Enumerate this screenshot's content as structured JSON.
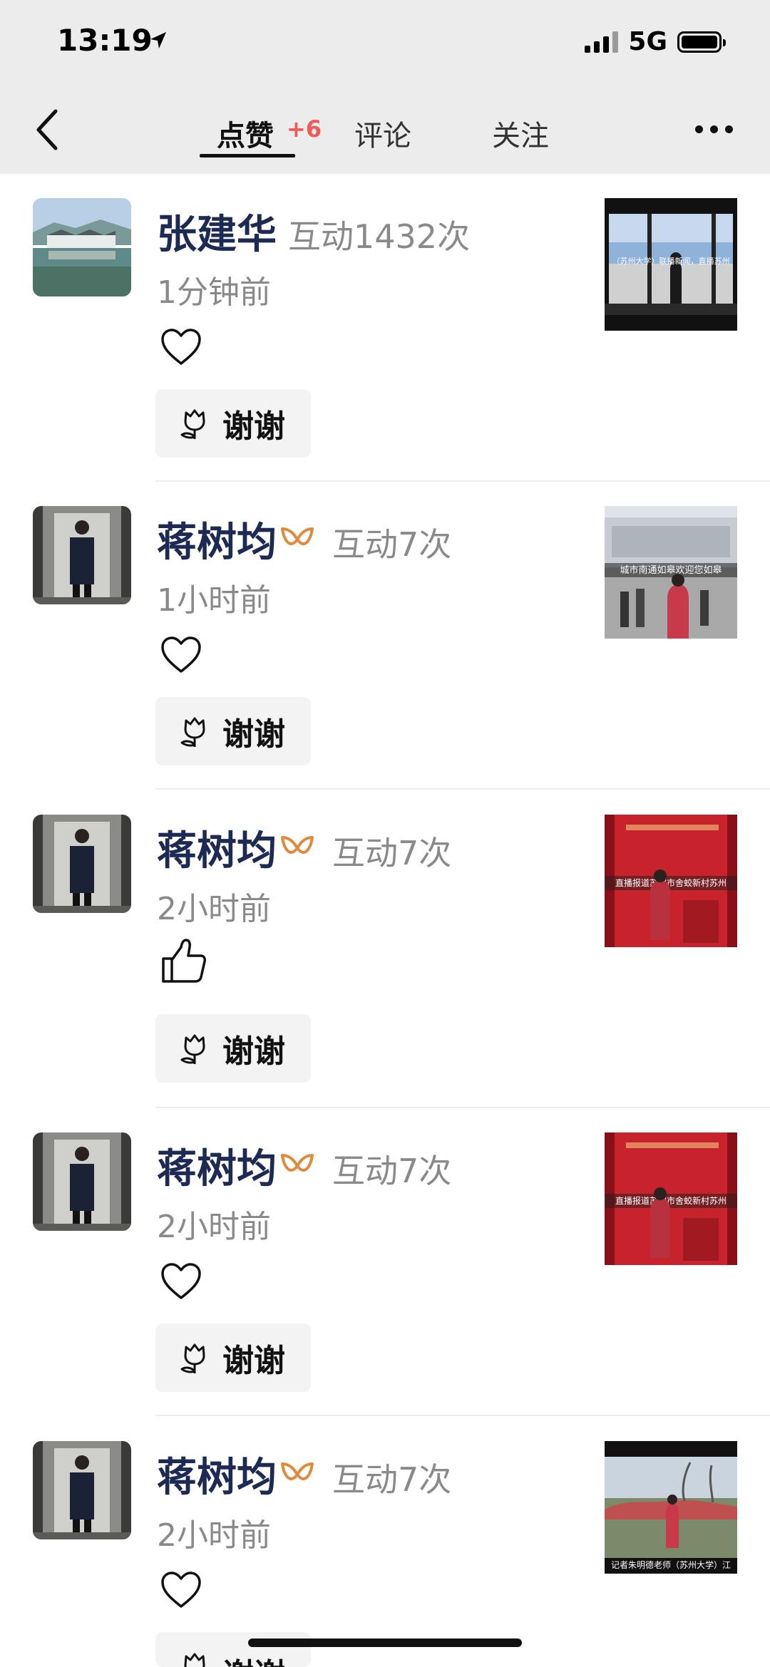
{
  "status_bar": {
    "time": "13:19",
    "network": "5G",
    "icons": [
      "location-arrow-icon",
      "signal-icon",
      "battery-icon"
    ]
  },
  "nav": {
    "tabs": [
      {
        "label": "点赞",
        "badge": "+6",
        "active": true
      },
      {
        "label": "评论",
        "active": false
      },
      {
        "label": "关注",
        "active": false
      }
    ],
    "icons": [
      "back-chevron-icon",
      "more-icon"
    ]
  },
  "colors": {
    "name": "#1c2a54",
    "badge": "#f25a5a",
    "muted": "#8a8a8a",
    "vip": "#e08a3c",
    "thanks_bg": "#f3f3f3"
  },
  "items": [
    {
      "name": "张建华",
      "vip": false,
      "interact": "互动1432次",
      "time": "1分钟前",
      "reaction": "heart-icon",
      "thanks": "谢谢",
      "thumb_caption": "（苏州大学）联播新闻，直播苏州"
    },
    {
      "name": "蒋树均",
      "vip": true,
      "interact": "互动7次",
      "time": "1小时前",
      "reaction": "heart-icon",
      "thanks": "谢谢",
      "thumb_caption": "城市南通如皋欢迎您如皋"
    },
    {
      "name": "蒋树均",
      "vip": true,
      "interact": "互动7次",
      "time": "2小时前",
      "reaction": "thumbs-up-icon",
      "thanks": "谢谢",
      "thumb_caption": "直播报道苏州市舍蛟新村苏州"
    },
    {
      "name": "蒋树均",
      "vip": true,
      "interact": "互动7次",
      "time": "2小时前",
      "reaction": "heart-icon",
      "thanks": "谢谢",
      "thumb_caption": "直播报道苏州市舍蛟新村苏州"
    },
    {
      "name": "蒋树均",
      "vip": true,
      "interact": "互动7次",
      "time": "2小时前",
      "reaction": "heart-icon",
      "thanks": "谢谢",
      "thumb_caption": "记者朱明德老师（苏州大学）江"
    }
  ]
}
